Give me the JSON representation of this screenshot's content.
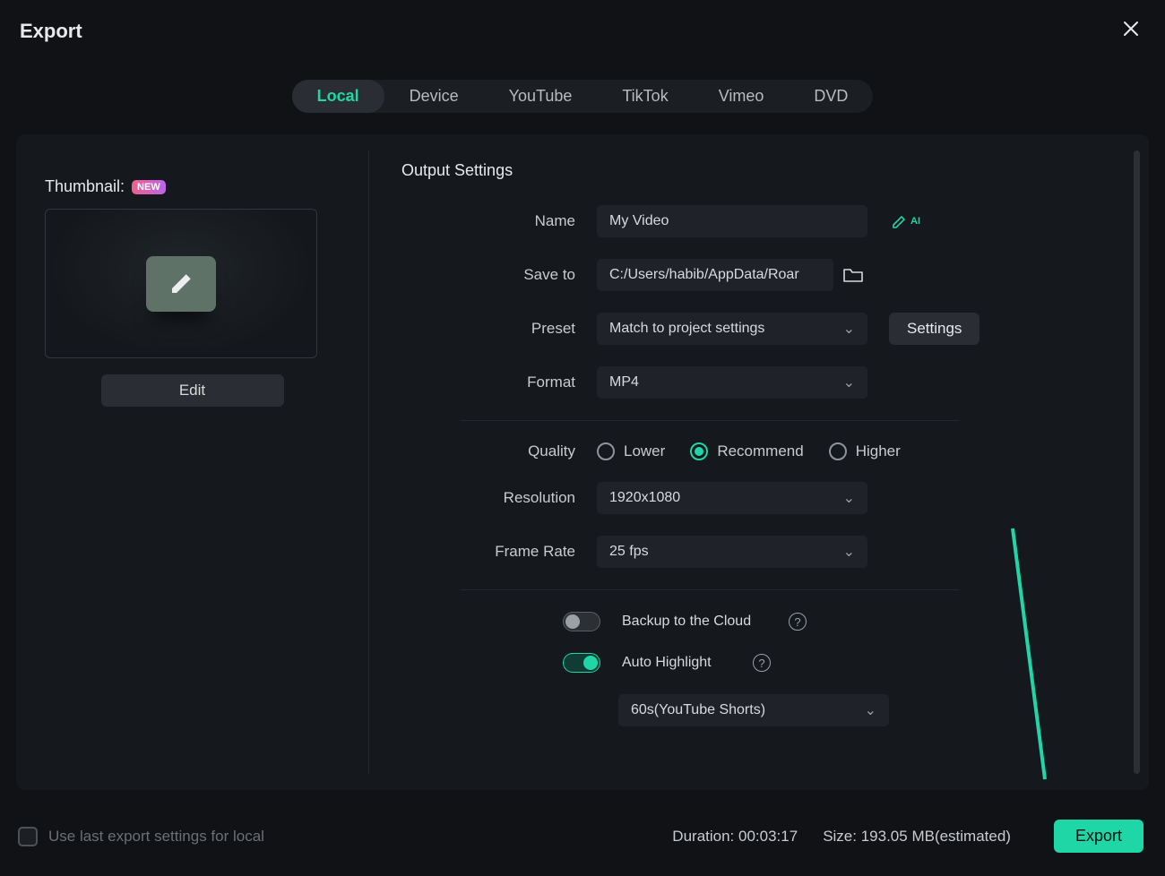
{
  "header": {
    "title": "Export"
  },
  "tabs": {
    "local": "Local",
    "device": "Device",
    "youtube": "YouTube",
    "tiktok": "TikTok",
    "vimeo": "Vimeo",
    "dvd": "DVD"
  },
  "thumbnail": {
    "label": "Thumbnail:",
    "badge": "NEW",
    "edit_label": "Edit"
  },
  "output": {
    "section_title": "Output Settings",
    "name_label": "Name",
    "name_value": "My Video",
    "saveto_label": "Save to",
    "saveto_value": "C:/Users/habib/AppData/Roar",
    "preset_label": "Preset",
    "preset_value": "Match to project settings",
    "settings_button": "Settings",
    "format_label": "Format",
    "format_value": "MP4",
    "quality_label": "Quality",
    "quality_options": {
      "lower": "Lower",
      "recommend": "Recommend",
      "higher": "Higher"
    },
    "resolution_label": "Resolution",
    "resolution_value": "1920x1080",
    "framerate_label": "Frame Rate",
    "framerate_value": "25 fps",
    "backup_label": "Backup to the Cloud",
    "autohighlight_label": "Auto Highlight",
    "shorts_value": "60s(YouTube Shorts)"
  },
  "footer": {
    "use_last_label": "Use last export settings for local",
    "duration_label": "Duration: ",
    "duration_value": "00:03:17",
    "size_label": "Size: ",
    "size_value": "193.05 MB(estimated)",
    "export_button": "Export"
  }
}
